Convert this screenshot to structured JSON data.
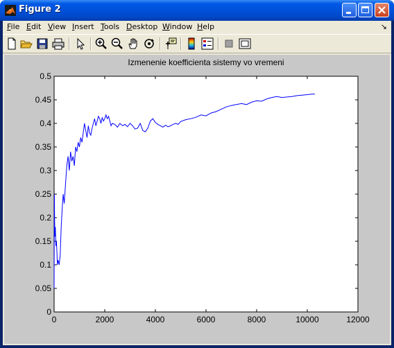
{
  "window": {
    "title": "Figure 2",
    "icon": "matlab-icon",
    "controls": [
      "minimize-icon",
      "maximize-icon",
      "close-icon"
    ]
  },
  "menu": {
    "items": [
      {
        "label": "File",
        "accel": "F",
        "rest": "ile"
      },
      {
        "label": "Edit",
        "accel": "E",
        "rest": "dit"
      },
      {
        "label": "View",
        "accel": "V",
        "rest": "iew"
      },
      {
        "label": "Insert",
        "accel": "I",
        "rest": "nsert"
      },
      {
        "label": "Tools",
        "accel": "T",
        "rest": "ools"
      },
      {
        "label": "Desktop",
        "accel": "D",
        "rest": "esktop"
      },
      {
        "label": "Window",
        "accel": "W",
        "rest": "indow"
      },
      {
        "label": "Help",
        "accel": "H",
        "rest": "elp"
      }
    ],
    "overflow_arrow": "↘"
  },
  "toolbar": {
    "tools": [
      "new-figure-icon",
      "open-file-icon",
      "save-icon",
      "print-icon",
      "edit-plot-icon",
      "zoom-in-icon",
      "zoom-out-icon",
      "pan-hand-icon",
      "rotate-3d-icon",
      "data-cursor-icon",
      "colorbar-icon",
      "legend-icon",
      "hide-plot-tools-icon",
      "show-plot-tools-icon"
    ]
  },
  "colors": {
    "figure_bg": "#c8c8c8",
    "axes_bg": "#ffffff",
    "line": "#0000ff",
    "titlebar": "#0054e3"
  },
  "chart_data": {
    "type": "line",
    "title": "Izmenenie koefficienta sistemy vo vremeni",
    "xlabel": "",
    "ylabel": "",
    "xlim": [
      0,
      12000
    ],
    "ylim": [
      0,
      0.5
    ],
    "xticks": [
      0,
      2000,
      4000,
      6000,
      8000,
      10000,
      12000
    ],
    "yticks": [
      0,
      0.05,
      0.1,
      0.15,
      0.2,
      0.25,
      0.3,
      0.35,
      0.4,
      0.45,
      0.5
    ],
    "ytick_labels": [
      "0",
      "0.05",
      "0.1",
      "0.15",
      "0.2",
      "0.25",
      "0.3",
      "0.35",
      "0.4",
      "0.45",
      "0.5"
    ],
    "grid": false,
    "series": [
      {
        "x": [
          0,
          10,
          20,
          30,
          50,
          70,
          90,
          110,
          130,
          160,
          200,
          240,
          280,
          320,
          360,
          400,
          450,
          500,
          550,
          600,
          650,
          700,
          750,
          800,
          850,
          900,
          950,
          1000,
          1050,
          1100,
          1150,
          1200,
          1250,
          1300,
          1350,
          1400,
          1450,
          1500,
          1550,
          1600,
          1650,
          1700,
          1750,
          1800,
          1850,
          1900,
          1950,
          2000,
          2050,
          2100,
          2150,
          2200,
          2250,
          2300,
          2400,
          2500,
          2600,
          2700,
          2800,
          2900,
          3000,
          3100,
          3200,
          3300,
          3400,
          3500,
          3600,
          3700,
          3800,
          3900,
          4000,
          4100,
          4200,
          4300,
          4400,
          4500,
          4600,
          4700,
          4800,
          4900,
          5000,
          5200,
          5400,
          5600,
          5800,
          6000,
          6200,
          6400,
          6600,
          6800,
          7000,
          7200,
          7400,
          7600,
          7800,
          8000,
          8200,
          8400,
          8600,
          8800,
          9000,
          9200,
          9400,
          9600,
          9800,
          10000,
          10200,
          10300
        ],
        "y": [
          0.05,
          0.25,
          0.2,
          0.16,
          0.18,
          0.14,
          0.15,
          0.13,
          0.1,
          0.11,
          0.1,
          0.12,
          0.18,
          0.22,
          0.25,
          0.23,
          0.27,
          0.31,
          0.33,
          0.3,
          0.34,
          0.32,
          0.33,
          0.31,
          0.35,
          0.34,
          0.36,
          0.35,
          0.37,
          0.36,
          0.38,
          0.4,
          0.385,
          0.37,
          0.395,
          0.38,
          0.375,
          0.39,
          0.4,
          0.41,
          0.395,
          0.405,
          0.415,
          0.41,
          0.4,
          0.412,
          0.405,
          0.41,
          0.418,
          0.41,
          0.415,
          0.405,
          0.395,
          0.4,
          0.398,
          0.392,
          0.4,
          0.395,
          0.398,
          0.393,
          0.4,
          0.395,
          0.388,
          0.39,
          0.4,
          0.385,
          0.382,
          0.39,
          0.405,
          0.41,
          0.402,
          0.398,
          0.395,
          0.392,
          0.396,
          0.393,
          0.395,
          0.398,
          0.4,
          0.398,
          0.404,
          0.408,
          0.41,
          0.413,
          0.418,
          0.416,
          0.422,
          0.425,
          0.43,
          0.435,
          0.438,
          0.44,
          0.442,
          0.44,
          0.445,
          0.448,
          0.447,
          0.452,
          0.455,
          0.457,
          0.455,
          0.456,
          0.457,
          0.459,
          0.46,
          0.461,
          0.462,
          0.462
        ]
      }
    ]
  }
}
